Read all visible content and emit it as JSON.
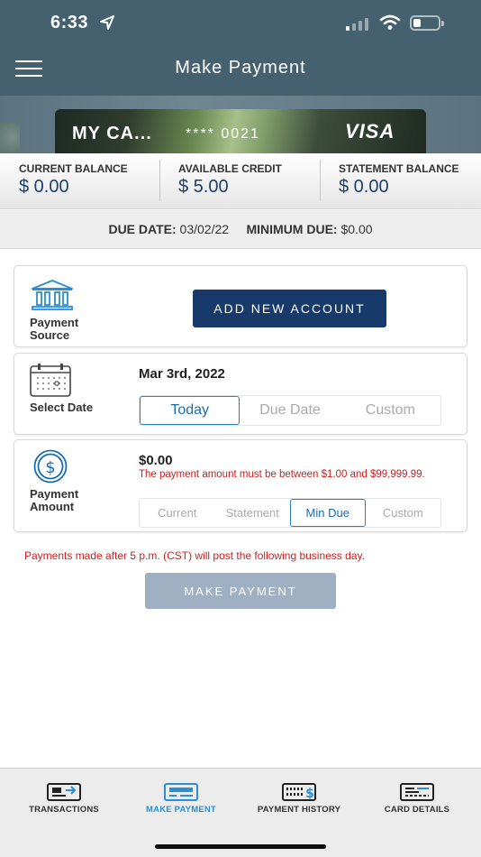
{
  "status_bar": {
    "time": "6:33"
  },
  "header": {
    "title": "Make Payment"
  },
  "card": {
    "name": "MY CA...",
    "number_masked": "**** 0021",
    "brand": "VISA"
  },
  "balances": [
    {
      "label": "CURRENT BALANCE",
      "value": "$ 0.00"
    },
    {
      "label": "AVAILABLE CREDIT",
      "value": "$ 5.00"
    },
    {
      "label": "STATEMENT BALANCE",
      "value": "$ 0.00"
    }
  ],
  "due": {
    "due_date_label": "DUE DATE:",
    "due_date_value": "03/02/22",
    "min_due_label": "MINIMUM DUE:",
    "min_due_value": "$0.00"
  },
  "payment_source": {
    "label_line1": "Payment",
    "label_line2": "Source",
    "button": "ADD NEW ACCOUNT"
  },
  "select_date": {
    "label": "Select Date",
    "value": "Mar 3rd, 2022",
    "options": [
      "Today",
      "Due Date",
      "Custom"
    ],
    "selected": "Today"
  },
  "payment_amount": {
    "label_line1": "Payment",
    "label_line2": "Amount",
    "value": "$0.00",
    "error": "The payment amount must be between $1.00 and $99,999.99.",
    "options": [
      "Current",
      "Statement",
      "Min Due",
      "Custom"
    ],
    "selected": "Min Due"
  },
  "notice": "Payments made after 5 p.m. (CST) will post the following business day.",
  "submit_button": "MAKE PAYMENT",
  "tabs": [
    {
      "label": "TRANSACTIONS",
      "icon": "transactions-icon"
    },
    {
      "label": "MAKE PAYMENT",
      "icon": "make-payment-icon"
    },
    {
      "label": "PAYMENT HISTORY",
      "icon": "payment-history-icon"
    },
    {
      "label": "CARD DETAILS",
      "icon": "card-details-icon"
    }
  ],
  "active_tab": "MAKE PAYMENT",
  "colors": {
    "header": "#45606f",
    "primary": "#173a6b",
    "accent": "#2a8fd6",
    "error": "#cc1f1f",
    "disabled": "#9eb0c2"
  }
}
